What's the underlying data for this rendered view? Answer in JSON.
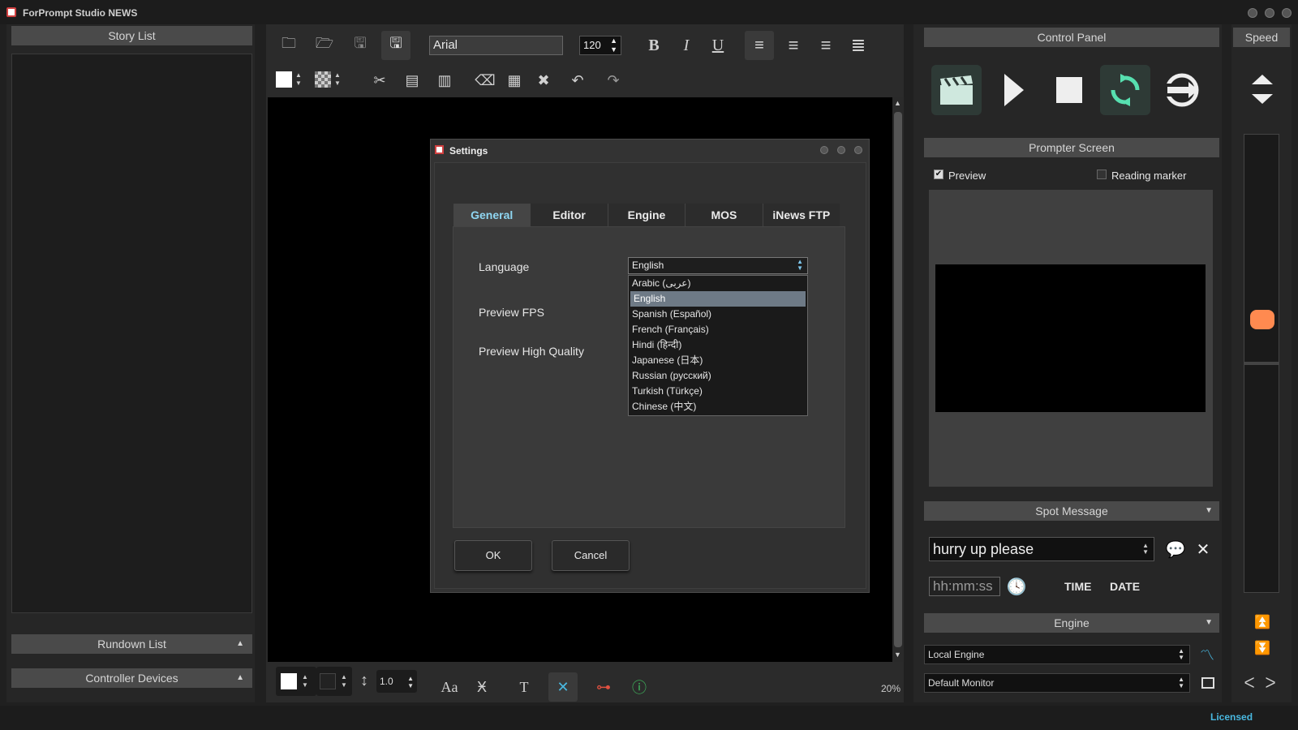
{
  "app": {
    "title": "ForPrompt Studio NEWS",
    "status": "Licensed"
  },
  "left": {
    "story_list": "Story List",
    "rundown_list": "Rundown List",
    "controller_devices": "Controller Devices"
  },
  "toolbar": {
    "font": "Arial",
    "size": "120",
    "bold": "B",
    "italic": "I",
    "underline": "U"
  },
  "bottom_toolbar": {
    "line_spacing": "1.0",
    "text_size": "Aa",
    "zoom": "20%",
    "t_label": "T"
  },
  "dialog": {
    "title": "Settings",
    "tabs": [
      "General",
      "Editor",
      "Engine",
      "MOS",
      "iNews FTP"
    ],
    "labels": {
      "language": "Language",
      "preview_fps": "Preview FPS",
      "preview_hq": "Preview High Quality"
    },
    "language_selected": "English",
    "language_options": [
      "Arabic (عربى)",
      "English",
      "Spanish (Español)",
      "French (Français)",
      "Hindi (हिन्दी)",
      "Japanese (日本)",
      "Russian (русский)",
      "Turkish (Türkçe)",
      "Chinese (中文)"
    ],
    "ok": "OK",
    "cancel": "Cancel"
  },
  "right": {
    "control_panel": "Control Panel",
    "prompter_screen": "Prompter Screen",
    "preview": "Preview",
    "reading_marker": "Reading marker",
    "spot_message": "Spot Message",
    "spot_value": "hurry up please",
    "time_placeholder": "hh:mm:ss",
    "time_btn": "TIME",
    "date_btn": "DATE",
    "engine": "Engine",
    "engine_value": "Local Engine",
    "monitor_value": "Default Monitor",
    "speed": "Speed"
  },
  "colors": {
    "accent": "#49b8e0",
    "active_tab": "#8fd6f2",
    "speed_knob": "#ff8a50",
    "loop": "#57e0b0"
  }
}
